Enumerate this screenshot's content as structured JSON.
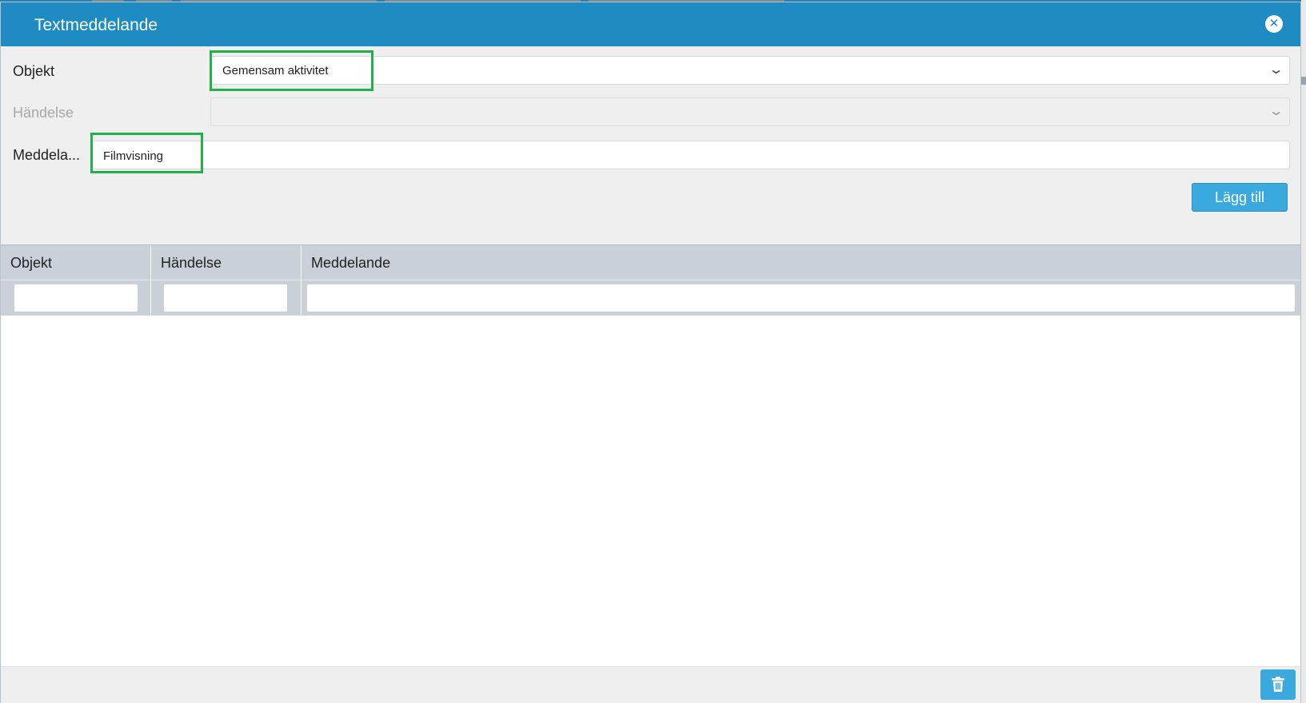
{
  "dialog": {
    "title": "Textmeddelande",
    "close_icon": "close-circle-icon"
  },
  "form": {
    "objekt_label": "Objekt",
    "objekt_value": "Gemensam aktivitet",
    "handelse_label": "Händelse",
    "handelse_value": "",
    "meddelande_label": "Meddela...",
    "meddelande_value": "Filmvisning",
    "add_button": "Lägg till"
  },
  "grid": {
    "columns": [
      "Objekt",
      "Händelse",
      "Meddelande"
    ],
    "filters": [
      "",
      "",
      ""
    ],
    "rows": []
  },
  "footer": {
    "delete_icon": "trash-icon"
  },
  "colors": {
    "titlebar": "#1e8bc3",
    "button": "#3aa9dd",
    "highlight": "#20b24a",
    "grid_header": "#c9d0d8"
  }
}
